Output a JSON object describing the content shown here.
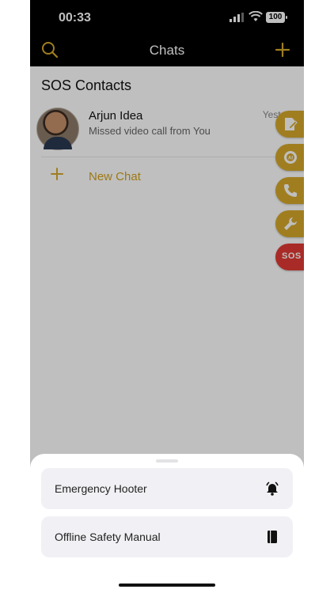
{
  "status": {
    "time": "00:33",
    "battery": "100"
  },
  "nav": {
    "title": "Chats"
  },
  "sections": {
    "sos_contacts": "SOS Contacts"
  },
  "chats": [
    {
      "name": "Arjun Idea",
      "message": "Missed video call from You",
      "time": "Yesterd"
    }
  ],
  "new_chat": {
    "label": "New Chat"
  },
  "fabs": {
    "sos_label": "SOS"
  },
  "sheet": {
    "options": [
      {
        "label": "Emergency Hooter",
        "icon": "alarm-bell-icon"
      },
      {
        "label": "Offline Safety Manual",
        "icon": "book-icon"
      }
    ]
  },
  "colors": {
    "accent": "#d6a92b",
    "sos": "#e23a34",
    "nav_bg": "#000000"
  }
}
